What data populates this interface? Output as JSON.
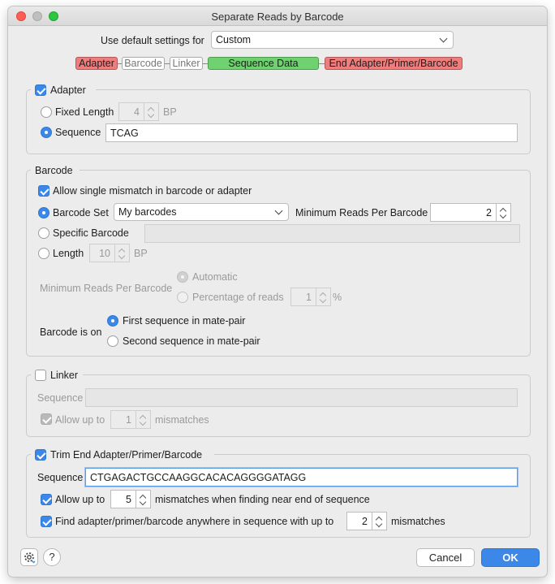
{
  "window": {
    "title": "Separate Reads by Barcode"
  },
  "preset": {
    "label": "Use default settings for",
    "value": "Custom"
  },
  "structure": {
    "segments": [
      {
        "label": "Adapter",
        "color": "#ee7e7e"
      },
      {
        "label": "Barcode",
        "color": "#ffffff"
      },
      {
        "label": "Linker",
        "color": "#ffffff"
      },
      {
        "label": "Sequence Data",
        "color": "#6fd16f"
      },
      {
        "label": "End Adapter/Primer/Barcode",
        "color": "#ee7e7e"
      }
    ]
  },
  "adapter": {
    "title": "Adapter",
    "enabled": true,
    "fixed_length_label": "Fixed Length",
    "fixed_length_value": "4",
    "bp": "BP",
    "sequence_label": "Sequence",
    "sequence_value": "TCAG"
  },
  "barcode": {
    "title": "Barcode",
    "allow_mismatch_label": "Allow single mismatch in barcode or adapter",
    "barcode_set_label": "Barcode Set",
    "barcode_set_value": "My barcodes",
    "min_reads_label": "Minimum Reads Per Barcode",
    "min_reads_value": "2",
    "specific_barcode_label": "Specific Barcode",
    "specific_barcode_value": "",
    "length_label": "Length",
    "length_value": "10",
    "bp": "BP",
    "min_reads_label2": "Minimum Reads Per Barcode",
    "automatic_label": "Automatic",
    "percentage_label": "Percentage of reads",
    "percentage_value": "1",
    "percent_sign": "%",
    "barcode_is_on_label": "Barcode is on",
    "first_label": "First sequence in mate-pair",
    "second_label": "Second sequence in mate-pair"
  },
  "linker": {
    "title": "Linker",
    "sequence_label": "Sequence",
    "sequence_value": "",
    "allow_up_to_label": "Allow up to",
    "mismatch_value": "1",
    "mismatches_label": "mismatches"
  },
  "trim": {
    "title": "Trim End Adapter/Primer/Barcode",
    "sequence_label": "Sequence",
    "sequence_value": "CTGAGACTGCCAAGGCACACAGGGGATAGG",
    "allow_up_to_label": "Allow up to",
    "allow_value": "5",
    "allow_suffix": "mismatches when finding near end of sequence",
    "find_label": "Find adapter/primer/barcode anywhere in sequence with up to",
    "find_value": "2",
    "find_suffix": "mismatches"
  },
  "footer": {
    "help_label": "?",
    "cancel_label": "Cancel",
    "ok_label": "OK"
  },
  "colors": {
    "accent": "#3b88e8",
    "segment_red": "#ee7e7e",
    "segment_green": "#6fd16f"
  }
}
